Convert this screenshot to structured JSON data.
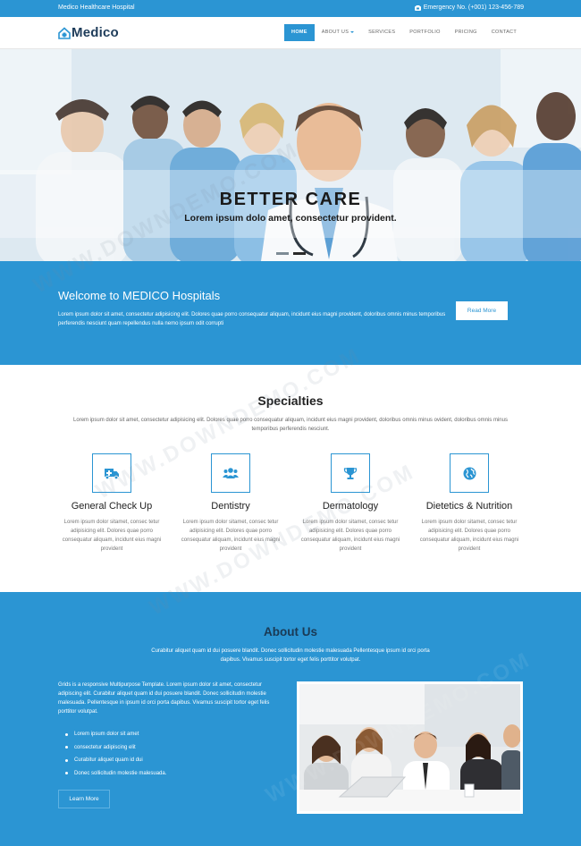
{
  "topbar": {
    "site_name": "Medico Healthcare Hospital",
    "emergency": "Emergency No. (+001) 123-456-789"
  },
  "nav": {
    "logo": "Medico",
    "items": [
      {
        "label": "HOME",
        "active": true
      },
      {
        "label": "ABOUT US",
        "dropdown": true
      },
      {
        "label": "SERVICES"
      },
      {
        "label": "PORTFOLIO"
      },
      {
        "label": "PRICING"
      },
      {
        "label": "CONTACT"
      }
    ]
  },
  "hero": {
    "title": "BETTER CARE",
    "subtitle": "Lorem ipsum dolo amet, consectetur provident.",
    "slides": 2,
    "active_slide": 2
  },
  "welcome": {
    "title": "Welcome to MEDICO Hospitals",
    "text": "Lorem ipsum dolor sit amet, consectetur adipisicing elit. Dolores quae porro consequatur aliquam, incidunt eius magni provident, doloribus omnis minus temporibus perferendis nesciunt quam repellendus nulla nemo ipsum odit corrupti",
    "button": "Read More"
  },
  "specialties": {
    "title": "Specialties",
    "intro": "Lorem ipsum dolor sit amet, consectetur adipisicing elit. Dolores quae porro consequatur aliquam, incidunt eius magni provident, doloribus omnis minus ovident, doloribus omnis minus temporibus perferendis nesciunt.",
    "items": [
      {
        "title": "General Check Up",
        "icon": "ambulance-icon",
        "desc": "Lorem ipsum dolor sitamet, consec tetur adipisicing elit. Dolores quae porro consequatur aliquam, incidunt eius magni provident"
      },
      {
        "title": "Dentistry",
        "icon": "users-icon",
        "desc": "Lorem ipsum dolor sitamet, consec tetur adipisicing elit. Dolores quae porro consequatur aliquam, incidunt eius magni provident"
      },
      {
        "title": "Dermatology",
        "icon": "trophy-icon",
        "desc": "Lorem ipsum dolor sitamet, consec tetur adipisicing elit. Dolores quae porro consequatur aliquam, incidunt eius magni provident"
      },
      {
        "title": "Dietetics & Nutrition",
        "icon": "globe-icon",
        "desc": "Lorem ipsum dolor sitamet, consec tetur adipisicing elit. Dolores quae porro consequatur aliquam, incidunt eius magni provident"
      }
    ]
  },
  "about": {
    "title": "About Us",
    "intro": "Curabitur aliquet quam id dui posuere blandit. Donec sollicitudin molestie malesuada Pellentesque ipsum id orci porta dapibus. Vivamus suscipit tortor eget felis porttitor volutpat.",
    "text": "Grids is a responsive Multipurpose Template. Lorem ipsum dolor sit amet, consectetur adipiscing elit. Curabitur aliquet quam id dui posuere blandit. Donec sollicitudin molestie malesuada. Pellentesque in ipsum id orci porta dapibus. Vivamus suscipit tortor eget felis porttitor volutpat.",
    "list": [
      "Lorem ipsum dolor sit amet",
      "consectetur adipiscing elit",
      "Curabitur aliquet quam id dui",
      "Donec sollicitudin molestie malesuada."
    ],
    "button": "Learn More"
  },
  "watermark": "WWW.DOWNDEMO.COM",
  "colors": {
    "primary": "#2b95d3",
    "dark_heading": "#1a3a55",
    "logo": "#1e3c5a"
  }
}
